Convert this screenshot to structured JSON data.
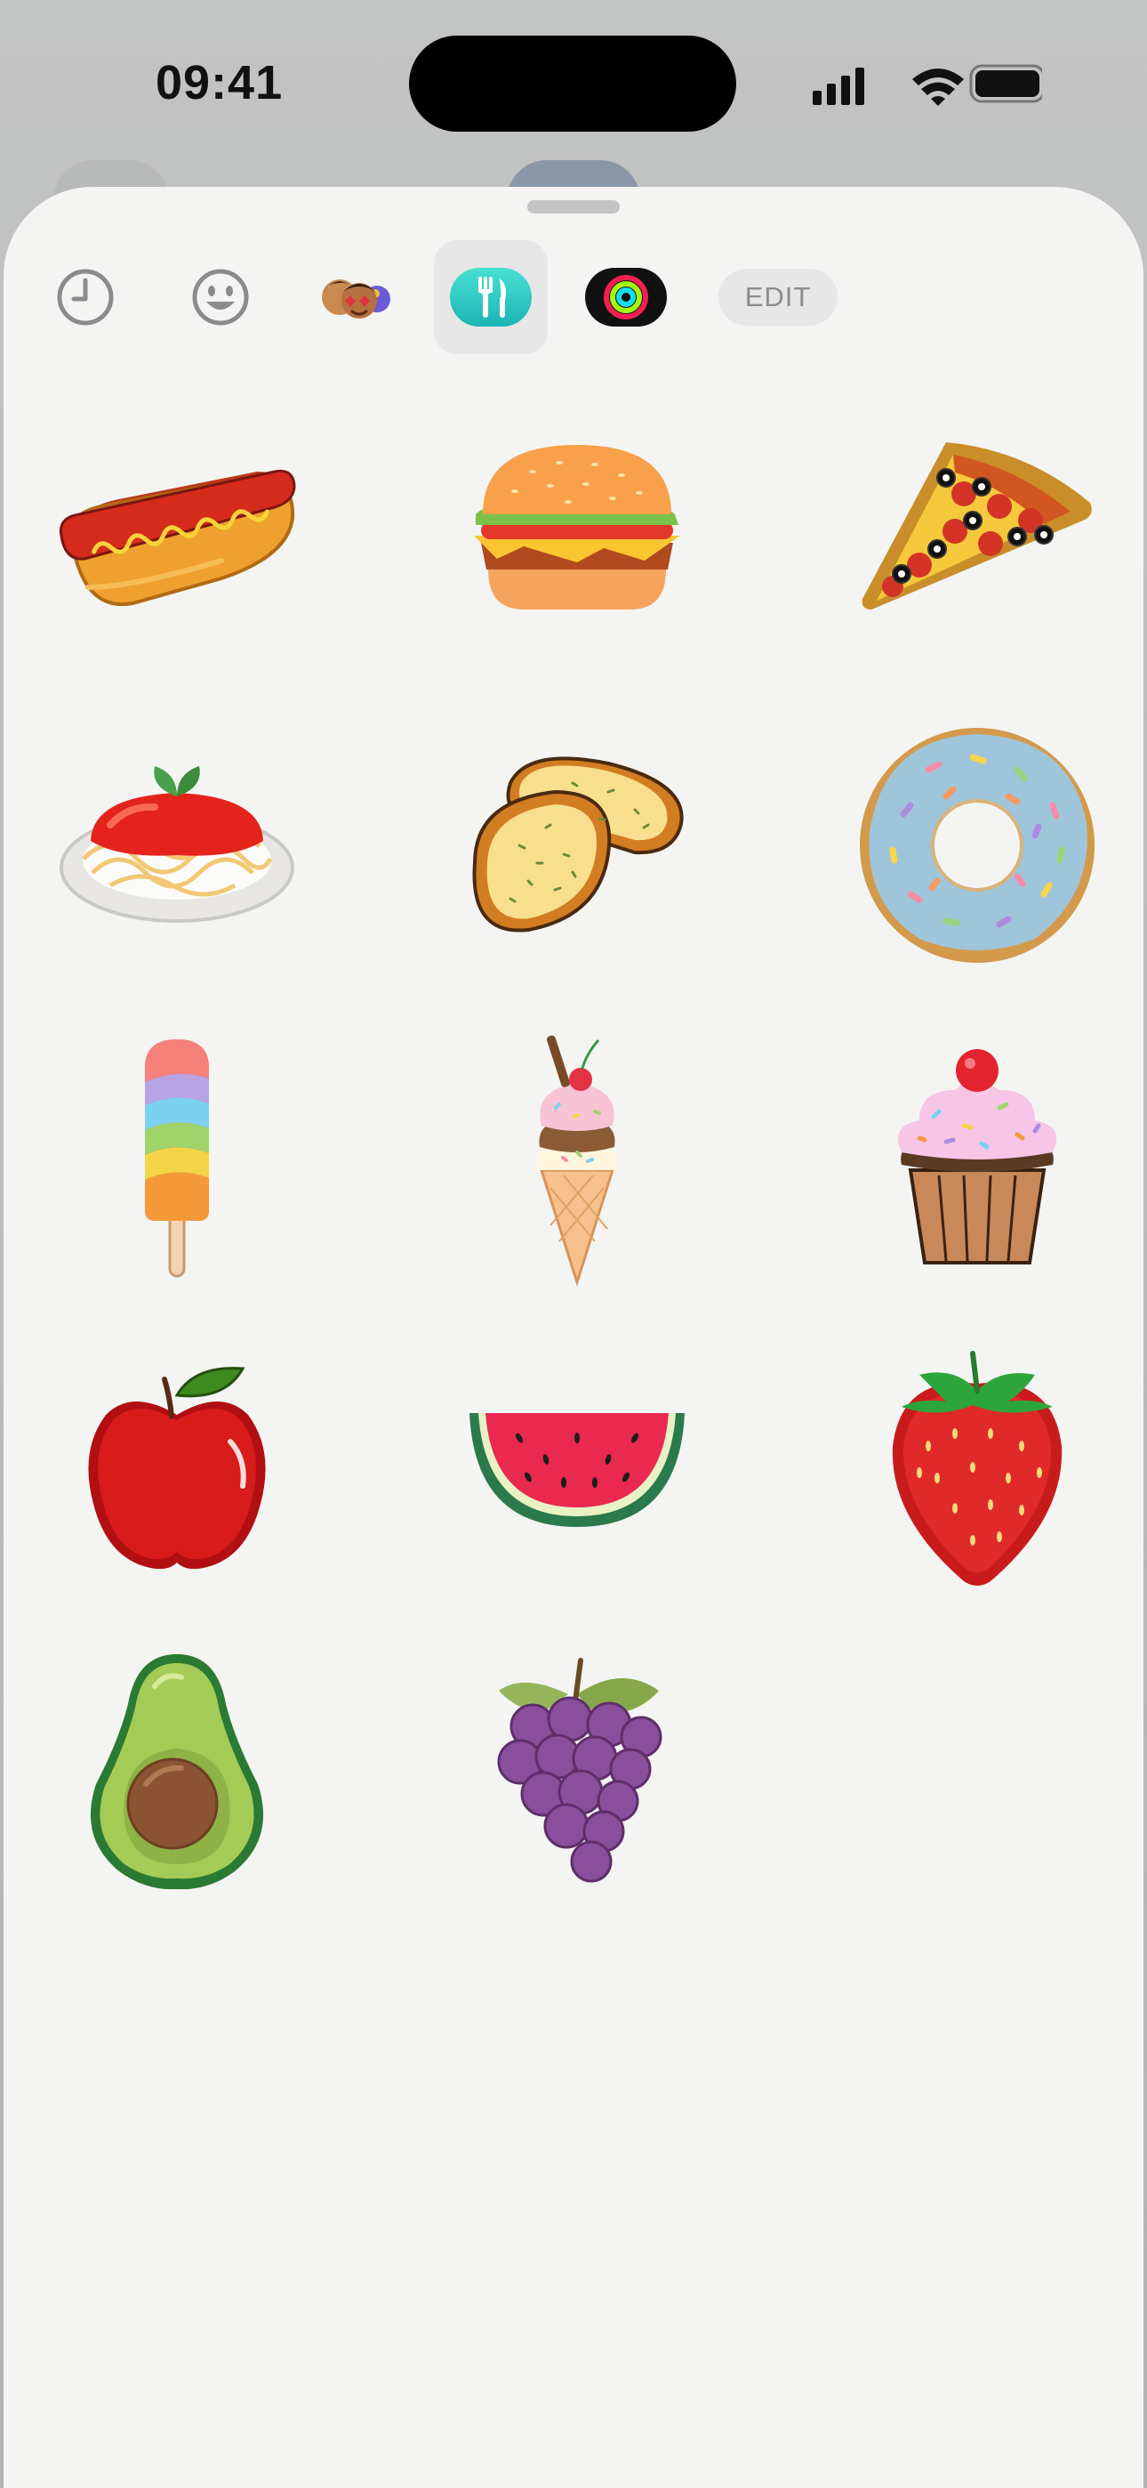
{
  "status_bar": {
    "time": "09:41"
  },
  "toolbar": {
    "tabs": [
      {
        "name": "recents",
        "icon": "clock-icon"
      },
      {
        "name": "emoji",
        "icon": "smiley-icon"
      },
      {
        "name": "memoji",
        "icon": "memoji-icon"
      },
      {
        "name": "food-stickers",
        "icon": "fork-knife-icon",
        "selected": true
      },
      {
        "name": "activity",
        "icon": "activity-rings-icon"
      }
    ],
    "edit_label": "EDIT"
  },
  "stickers": [
    "hot-dog",
    "hamburger",
    "pizza-slice",
    "spaghetti",
    "garlic-bread",
    "donut",
    "popsicle",
    "ice-cream-cone",
    "cupcake",
    "apple",
    "watermelon",
    "strawberry",
    "avocado",
    "grapes"
  ],
  "colors": {
    "sheet_background": "#f4f5f3",
    "food_tab_accent": "#2ec7c0"
  }
}
